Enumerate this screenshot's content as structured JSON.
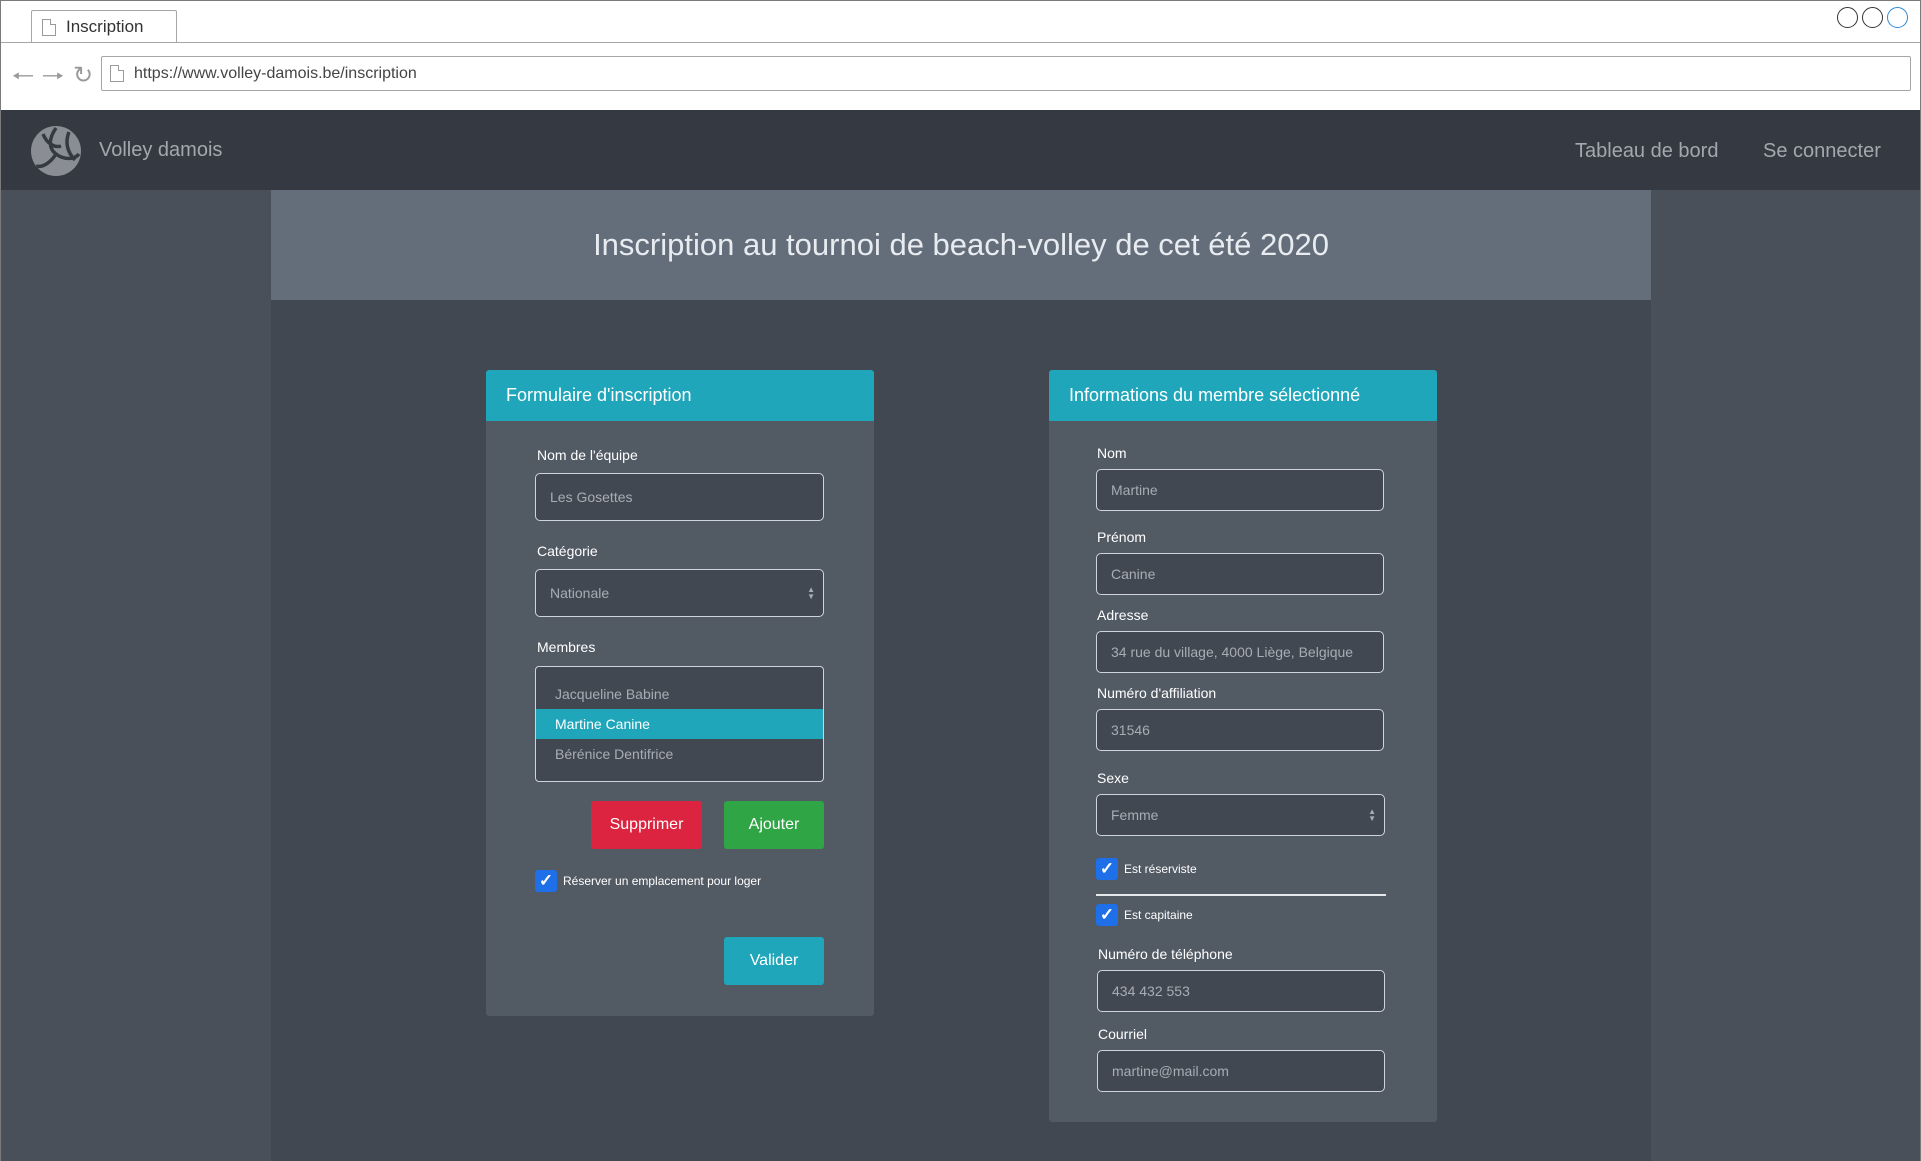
{
  "browser": {
    "tab_title": "Inscription",
    "url": "https://www.volley-damois.be/inscription"
  },
  "nav": {
    "brand": "Volley damois",
    "links": [
      "Tableau de bord",
      "Se connecter"
    ]
  },
  "page_title": "Inscription au tournoi de beach-volley de cet été 2020",
  "form": {
    "header": "Formulaire d'inscription",
    "team_label": "Nom de l'équipe",
    "team_value": "Les Gosettes",
    "category_label": "Catégorie",
    "category_value": "Nationale",
    "members_label": "Membres",
    "members": [
      "Jacqueline Babine",
      "Martine Canine",
      "Bérénice Dentifrice"
    ],
    "selected_member": "Martine Canine",
    "delete_button": "Supprimer",
    "add_button": "Ajouter",
    "lodging_label": "Réserver un emplacement pour loger",
    "lodging_checked": true,
    "submit_button": "Valider"
  },
  "member": {
    "header": "Informations du membre sélectionné",
    "nom_label": "Nom",
    "nom_value": "Martine",
    "prenom_label": "Prénom",
    "prenom_value": "Canine",
    "adresse_label": "Adresse",
    "adresse_value": "34 rue du village, 4000 Liège, Belgique",
    "affiliation_label": "Numéro d'affiliation",
    "affiliation_value": "31546",
    "sexe_label": "Sexe",
    "sexe_value": "Femme",
    "reserviste_label": "Est réserviste",
    "reserviste_checked": true,
    "capitaine_label": "Est capitaine",
    "capitaine_checked": true,
    "telephone_label": "Numéro de téléphone",
    "telephone_value": "434 432 553",
    "courriel_label": "Courriel",
    "courriel_value": "martine@mail.com"
  },
  "colors": {
    "accent": "#1fa6ba",
    "danger": "#dc2440",
    "success": "#2fa546",
    "navbar": "#353a42",
    "checkbox": "#1f6fe8"
  }
}
